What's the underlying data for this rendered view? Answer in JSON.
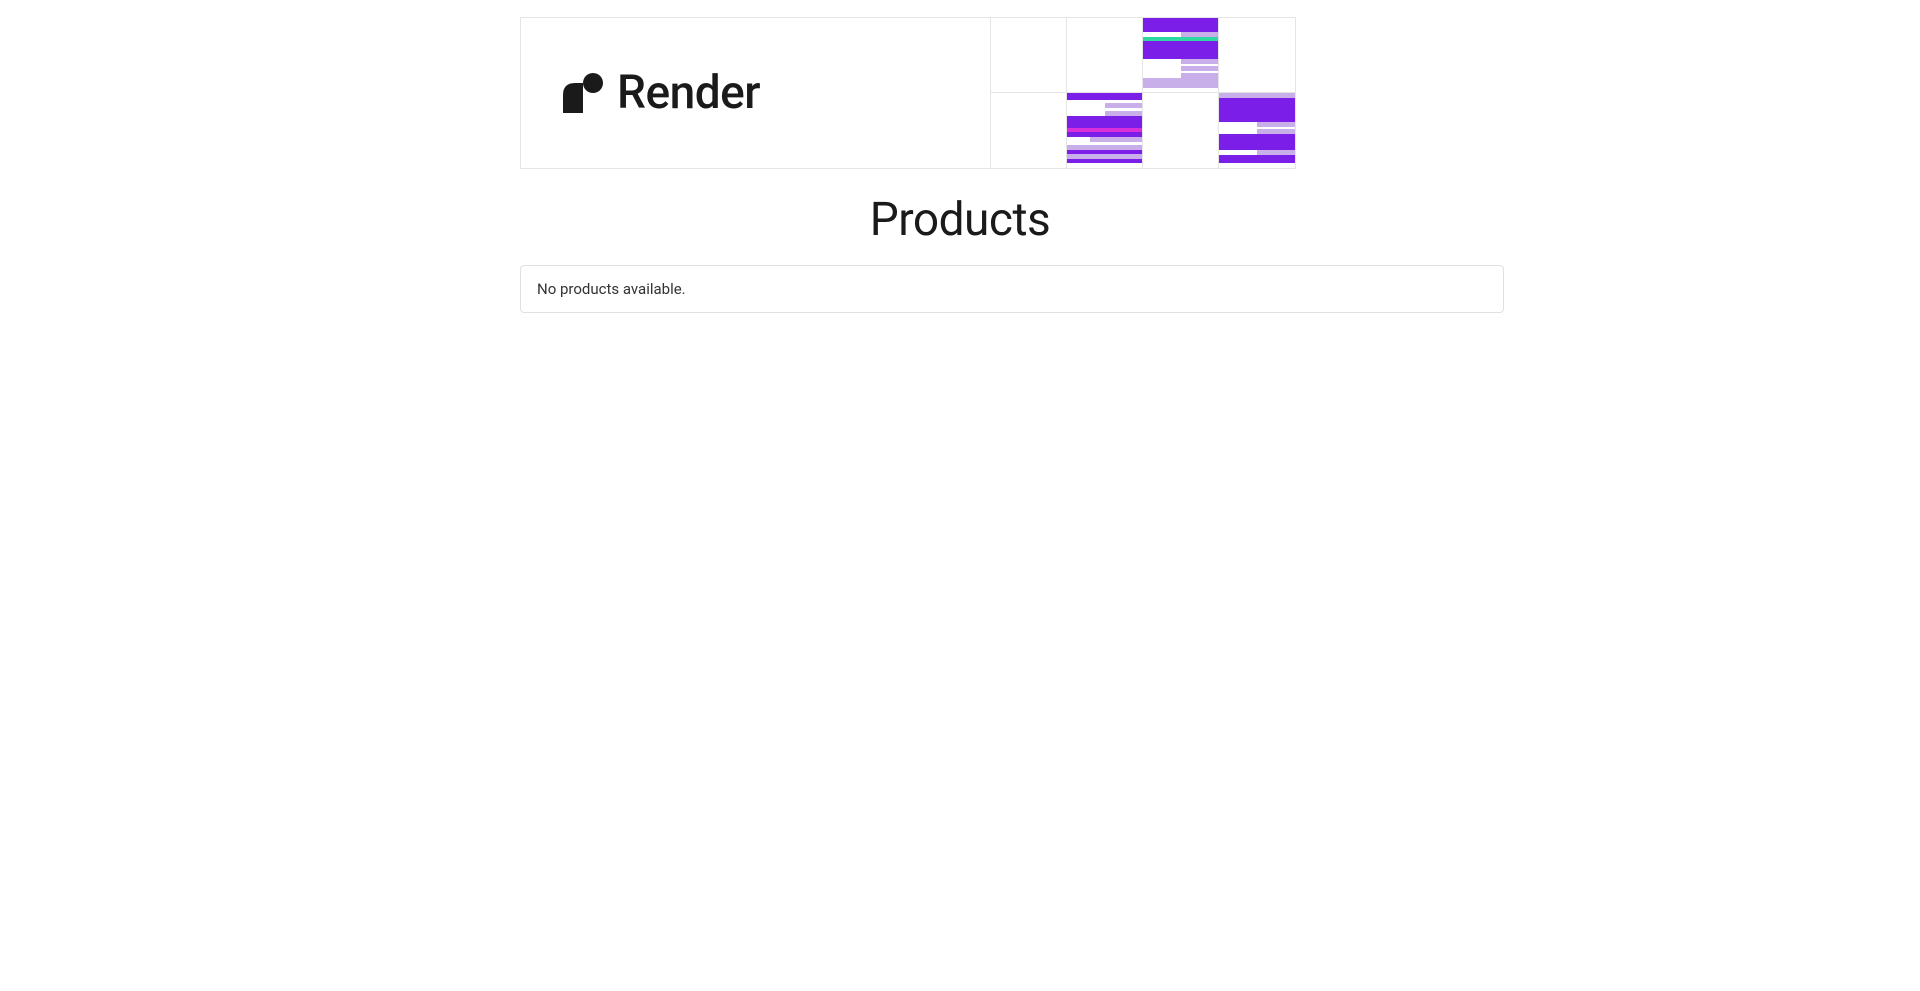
{
  "brand": {
    "name": "Render"
  },
  "page": {
    "title": "Products",
    "empty_message": "No products available."
  },
  "banner": {
    "colors": {
      "purple_dark": "#7b1fe8",
      "purple_light": "#c9afea",
      "green": "#2dd8a3",
      "magenta": "#d82fd8",
      "white": "#ffffff"
    }
  }
}
